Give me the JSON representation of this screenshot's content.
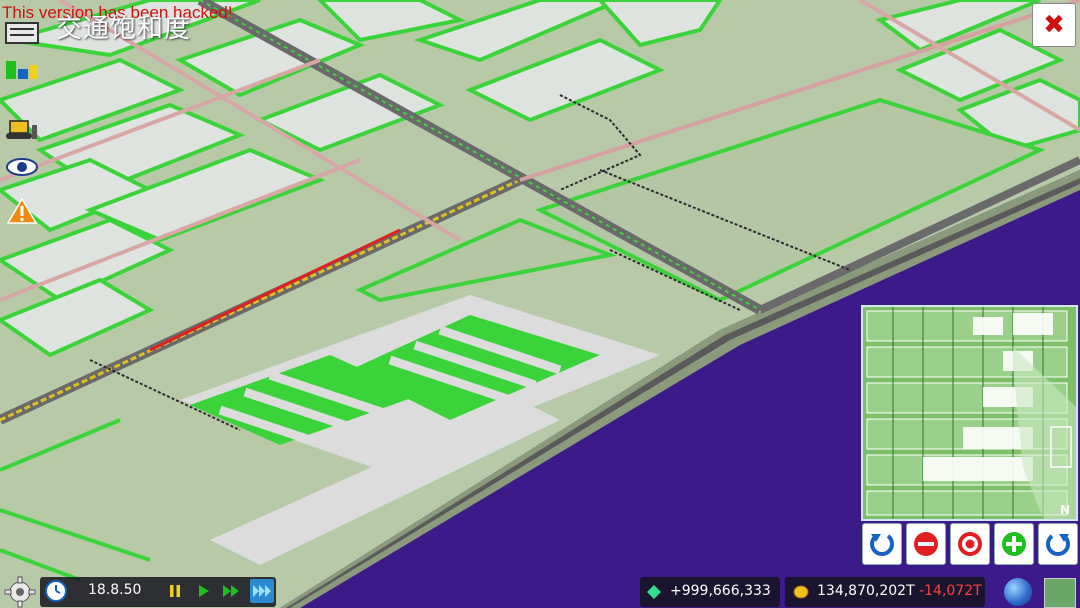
{
  "hack_banner": "This version has been hacked!",
  "window_title": "交通饱和度",
  "close_label": "✖",
  "time": {
    "value": "18.8.50"
  },
  "stats": {
    "diamonds": "+999,666,333",
    "cash": "134,870,202T",
    "cash_change": "-14,072T"
  },
  "minimap": {
    "compass": "N"
  },
  "icons": {
    "menu": "menu-icon",
    "layers": "layers-icon",
    "bulldozer": "bulldozer-icon",
    "eye": "eye-icon",
    "warning": "warning-icon",
    "settings": "gear-icon",
    "clock": "clock-icon",
    "diamond": "diamond-icon",
    "coin": "coin-icon",
    "globe": "globe-icon",
    "map": "map-icon"
  },
  "colors": {
    "ground": "#b8c9a8",
    "grass": "#3ad43a",
    "block": "#dfe3df",
    "water": "#3d1a8a",
    "road": "#7a7a7a",
    "jam_red": "#e02020",
    "accent_blue": "#1565c0"
  }
}
